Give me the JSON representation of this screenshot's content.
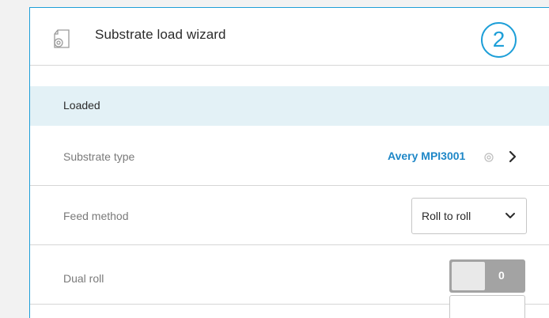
{
  "header": {
    "title": "Substrate load wizard",
    "icon": "substrate-roll-icon",
    "step": "2"
  },
  "status": {
    "label": "Loaded"
  },
  "rows": {
    "substrate_type": {
      "label": "Substrate type",
      "value": "Avery MPI3001",
      "icons": [
        "gear-icon",
        "chevron-right-icon"
      ]
    },
    "feed_method": {
      "label": "Feed method",
      "value": "Roll to roll",
      "icon": "chevron-down-icon"
    },
    "dual_roll": {
      "label": "Dual roll",
      "state": "0"
    }
  },
  "colors": {
    "accent": "#1e9fd8",
    "link": "#1e87c7",
    "status_bg": "#e3f1f6",
    "toggle_off": "#a3a3a3"
  }
}
